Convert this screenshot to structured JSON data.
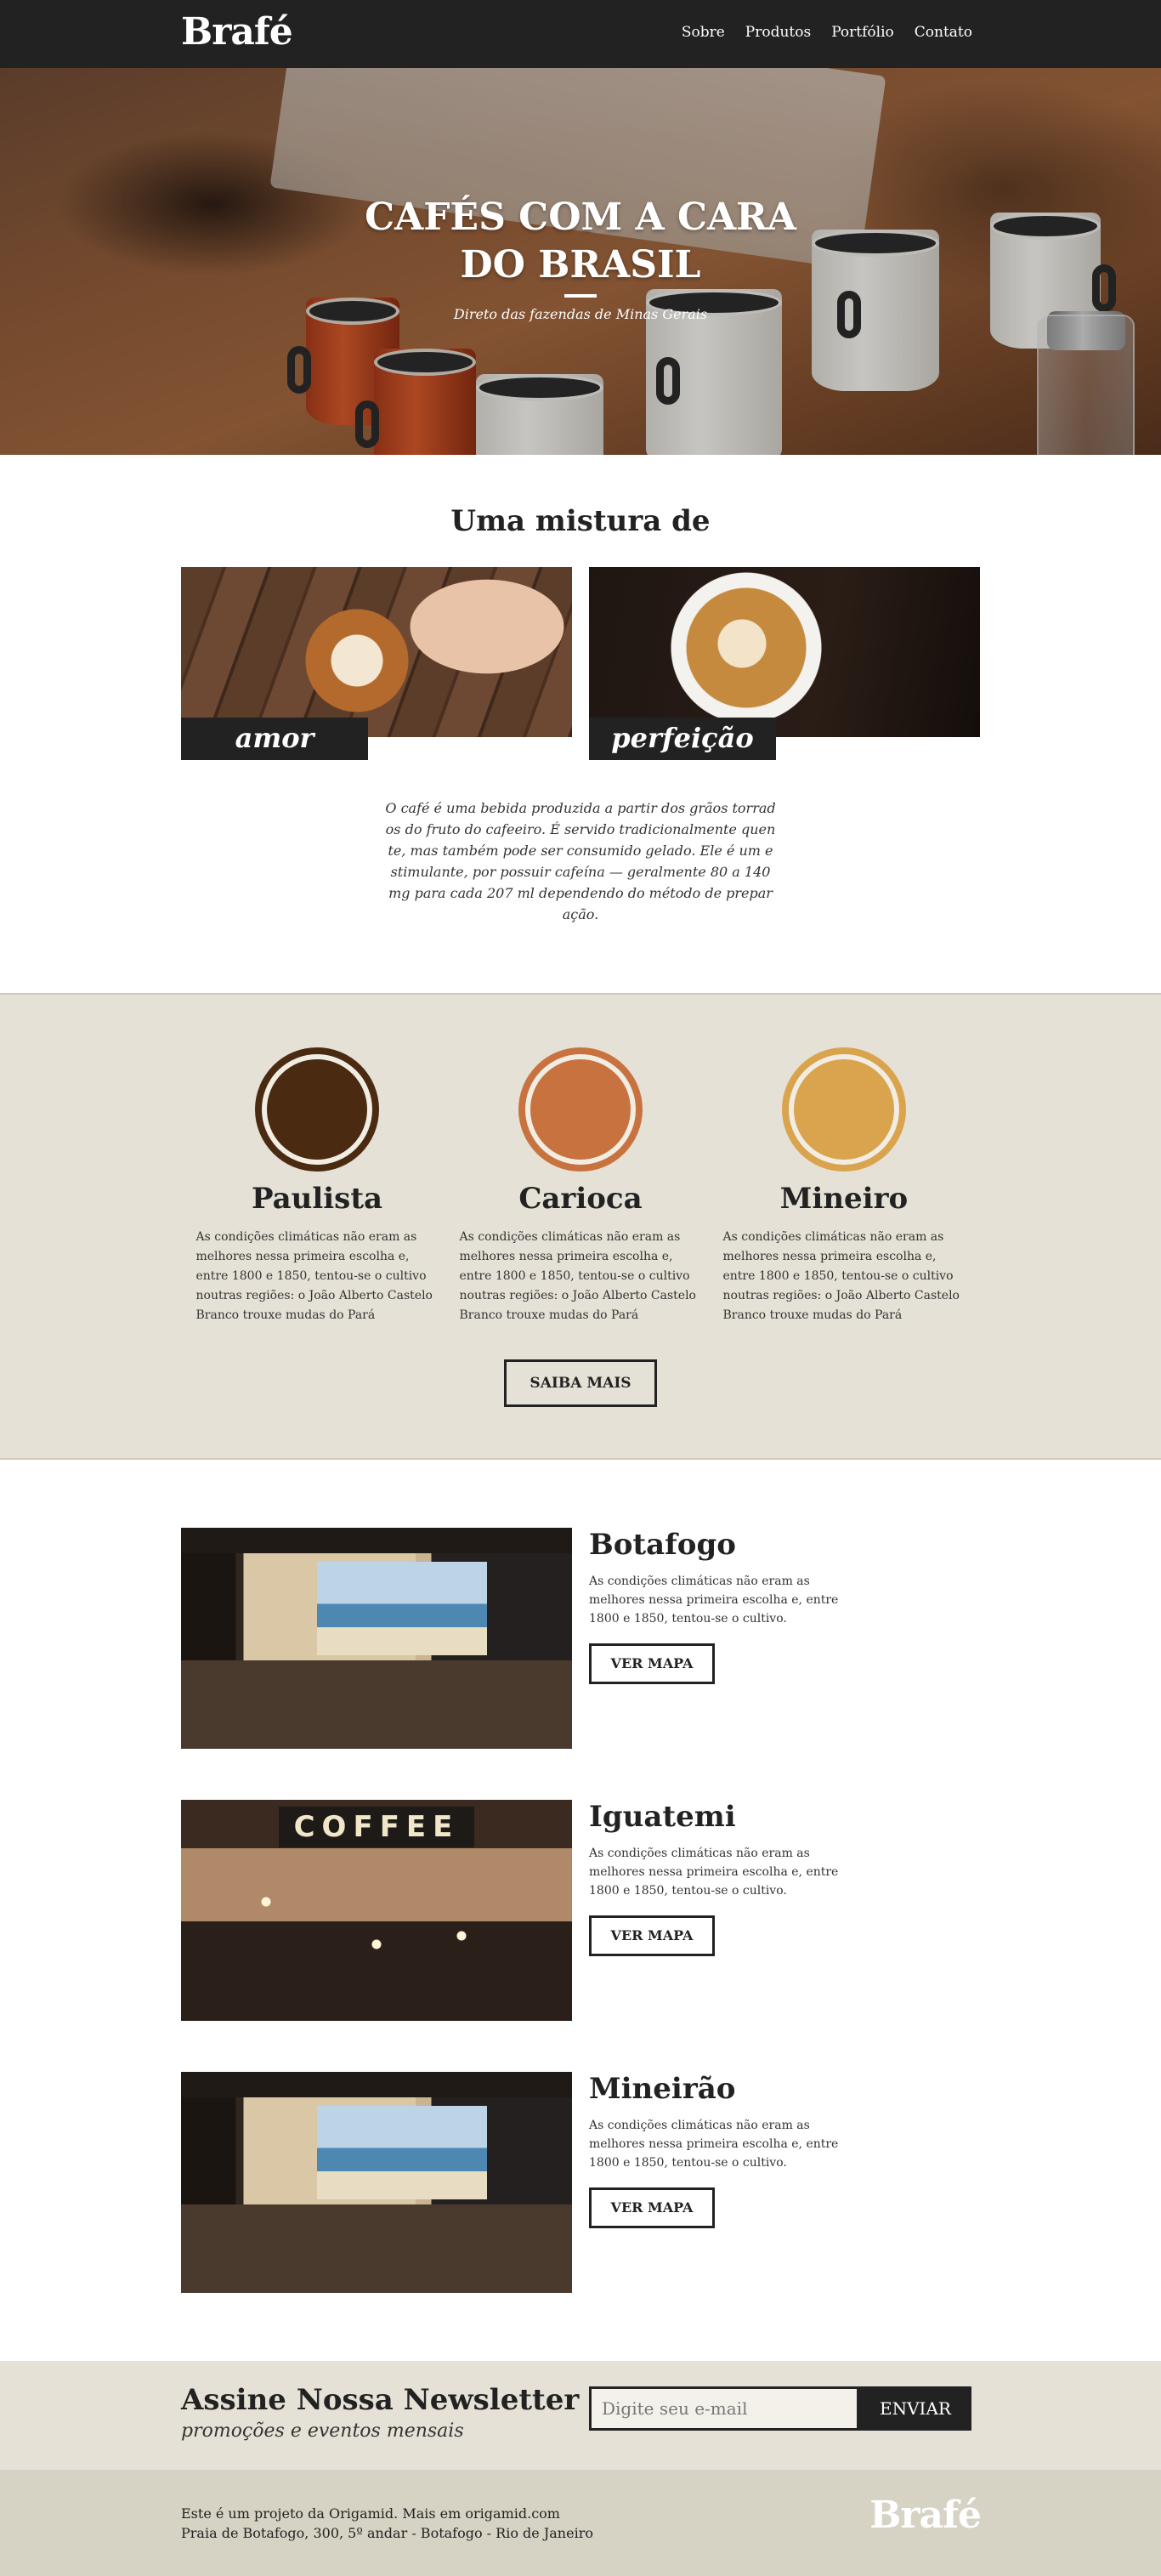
{
  "header": {
    "logo": "Brafé",
    "nav": [
      "Sobre",
      "Produtos",
      "Portfólio",
      "Contato"
    ]
  },
  "hero": {
    "title": "CAFÉS COM A CARA DO BRASIL",
    "subtitle": "Direto das fazendas de Minas Gerais"
  },
  "intro": {
    "title": "Uma mistura de",
    "cards": [
      "amor",
      "perfeição"
    ],
    "text": "O café é uma bebida produzida a partir dos grãos torrados do fruto do cafeeiro. É servido tradicionalmente quente, mas também pode ser consumido gelado. Ele é um estimulante, por possuir cafeína — geralmente 80 a 140 mg para cada 207 ml dependendo do método de preparação."
  },
  "origins": {
    "items": [
      {
        "name": "Paulista",
        "color": "#4a2a10",
        "text": "As condições climáticas não eram as melhores nessa primeira escolha e, entre 1800 e 1850, tentou-se o cultivo noutras regiões: o João Alberto Castelo Branco trouxe mudas do Pará"
      },
      {
        "name": "Carioca",
        "color": "#c8733f",
        "text": "As condições climáticas não eram as melhores nessa primeira escolha e, entre 1800 e 1850, tentou-se o cultivo noutras regiões: o João Alberto Castelo Branco trouxe mudas do Pará"
      },
      {
        "name": "Mineiro",
        "color": "#d9a44d",
        "text": "As condições climáticas não eram as melhores nessa primeira escolha e, entre 1800 e 1850, tentou-se o cultivo noutras regiões: o João Alberto Castelo Branco trouxe mudas do Pará"
      }
    ],
    "button": "SAIBA MAIS"
  },
  "locations": [
    {
      "name": "Botafogo",
      "text": "As condições climáticas não eram as melhores nessa primeira escolha e, entre 1800 e 1850, tentou-se o cultivo.",
      "button": "VER MAPA"
    },
    {
      "name": "Iguatemi",
      "text": "As condições climáticas não eram as melhores nessa primeira escolha e, entre 1800 e 1850, tentou-se o cultivo.",
      "button": "VER MAPA",
      "sign": "COFFEE"
    },
    {
      "name": "Mineirão",
      "text": "As condições climáticas não eram as melhores nessa primeira escolha e, entre 1800 e 1850, tentou-se o cultivo.",
      "button": "VER MAPA"
    }
  ],
  "newsletter": {
    "title": "Assine Nossa Newsletter",
    "subtitle": "promoções e eventos mensais",
    "placeholder": "Digite seu e-mail",
    "button": "ENVIAR"
  },
  "footer": {
    "line1": "Este é um projeto da Origamid. Mais em origamid.com",
    "line2": "Praia de Botafogo, 300, 5º andar - Botafogo - Rio de Janeiro",
    "logo": "Brafé"
  }
}
